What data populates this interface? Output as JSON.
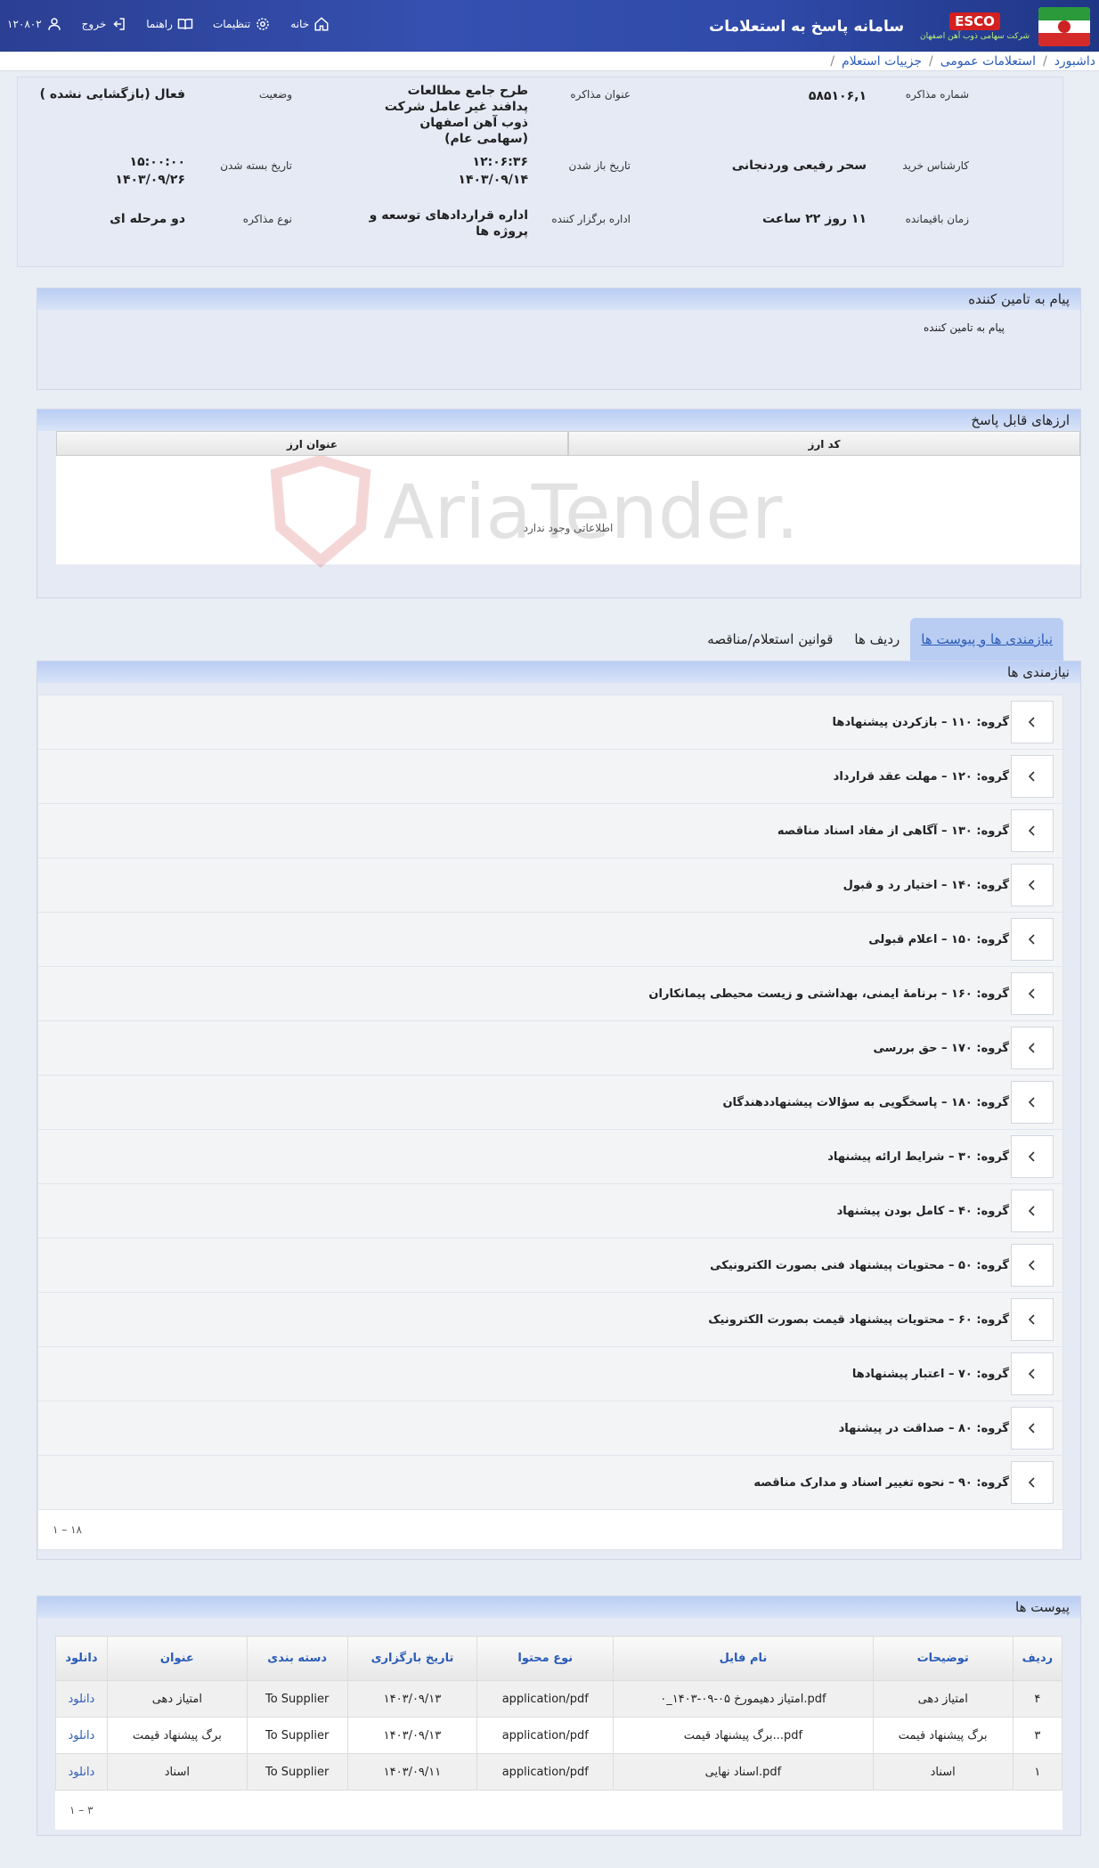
{
  "header": {
    "app_title": "سامانه پاسخ به استعلامات",
    "esco_label": "ESCO",
    "esco_sub": "شرکت سهامی ذوب آهن اصفهان",
    "nav": {
      "home": "خانه",
      "settings": "تنظیمات",
      "guide": "راهنما",
      "logout": "خروج",
      "user": "۱۲۰۸۰۲"
    }
  },
  "breadcrumb": {
    "items": [
      "داشبورد",
      "استعلامات عمومی",
      "جزییات استعلام"
    ]
  },
  "info": {
    "number_label": "شماره مذاکره",
    "number_value": "۵۸۵۱۰۶,۱",
    "title_label": "عنوان مذاکره",
    "title_value": "طرح جامع مطالعات پدافند غیر عامل شرکت ذوب آهن اصفهان (سهامی عام)",
    "status_label": "وضعیت",
    "status_value": "فعال (بازگشایی نشده )",
    "expert_label": "کارشناس خرید",
    "expert_value": "سحر رفیعی وردنجانی",
    "open_date_label": "تاریخ باز شدن",
    "open_time": "۱۲:۰۶:۳۶",
    "open_date": "۱۴۰۳/۰۹/۱۴",
    "close_date_label": "تاریخ بسته شدن",
    "close_time": "۱۵:۰۰:۰۰",
    "close_date": "۱۴۰۳/۰۹/۲۶",
    "remaining_label": "زمان باقیمانده",
    "remaining_value": "۱۱ روز ۲۲ ساعت",
    "organizer_label": "اداره برگزار کننده",
    "organizer_value": "اداره قراردادهای توسعه و پروژه ها",
    "type_label": "نوع مذاکره",
    "type_value": "دو مرحله ای"
  },
  "supplier_message": {
    "header": "پیام به تامین کننده",
    "label": "پیام به تامین کننده"
  },
  "currencies": {
    "header": "ارزهای قابل پاسخ",
    "columns": [
      "کد ارز",
      "عنوان ارز"
    ],
    "empty": "اطلاعاتی وجود ندارد"
  },
  "watermark": "AriaTender.net",
  "tabs": [
    "نیازمندی ها و پیوست ها",
    "ردیف ها",
    "قوانین استعلام/مناقصه"
  ],
  "requirements": {
    "header": "نیازمندی ها",
    "groups": [
      "گروه: ۱۱۰ – بازکردن پیشنهادها",
      "گروه: ۱۲۰ – مهلت عقد قرارداد",
      "گروه: ۱۳۰ – آگاهی از مفاد اسناد مناقصه",
      "گروه: ۱۴۰ – اختیار رد و قبول",
      "گروه: ۱۵۰ – اعلام قبولی",
      "گروه: ۱۶۰ – برنامهٔ ایمنی، بهداشتی و زیست محیطی پیمانکاران",
      "گروه: ۱۷۰ – حق بررسی",
      "گروه: ۱۸۰ – پاسخگویی به سؤالات پیشنهاددهندگان",
      "گروه: ۳۰ – شرایط ارائه پیشنهاد",
      "گروه: ۴۰ – کامل بودن پیشنهاد",
      "گروه: ۵۰ – محتویات پیشنهاد فنی بصورت الکترونیکی",
      "گروه: ۶۰ – محتویات پیشنهاد قیمت بصورت الکترونیک",
      "گروه: ۷۰ – اعتبار پیشنهادها",
      "گروه: ۸۰ – صداقت در پیشنهاد",
      "گروه: ۹۰ – نحوه تغییر اسناد و مدارک مناقصه"
    ],
    "pager": "۱ – ۱۸"
  },
  "attachments": {
    "header": "پیوست ها",
    "columns": [
      "ردیف",
      "توضیحات",
      "نام فایل",
      "نوع محتوا",
      "تاریخ بارگزاری",
      "دسته بندی",
      "عنوان",
      "دانلود"
    ],
    "rows": [
      [
        "۴",
        "امتیاز دهی",
        "۰_امتیاز دهیمورخ ۰۵-۰۹-۱۴۰۳.pdf",
        "application/pdf",
        "۱۴۰۳/۰۹/۱۳",
        "To Supplier",
        "امتیاز دهی",
        "دانلود"
      ],
      [
        "۳",
        "برگ پیشنهاد قیمت",
        "برگ پیشنهاد قیمت...pdf",
        "application/pdf",
        "۱۴۰۳/۰۹/۱۳",
        "To Supplier",
        "برگ پیشنهاد قیمت",
        "دانلود"
      ],
      [
        "۱",
        "اسناد",
        "اسناد نهایی.pdf",
        "application/pdf",
        "۱۴۰۳/۰۹/۱۱",
        "To Supplier",
        "اسناد",
        "دانلود"
      ]
    ],
    "pager": "۱ – ۳"
  }
}
